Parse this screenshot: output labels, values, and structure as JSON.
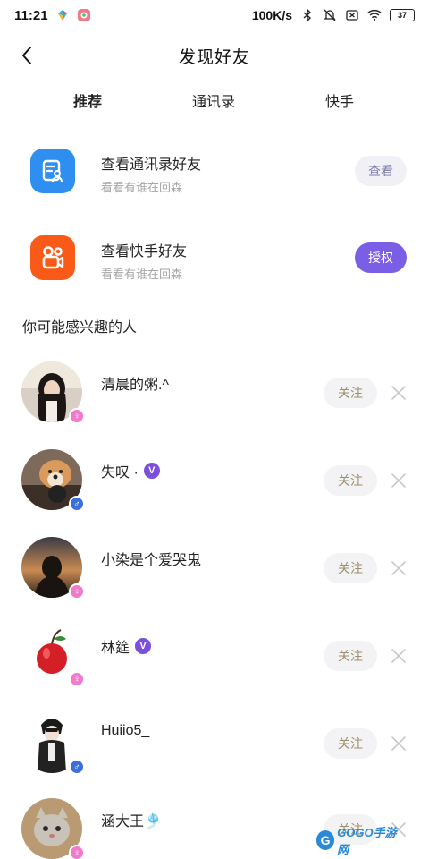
{
  "status_bar": {
    "time": "11:21",
    "network_speed": "100K/s",
    "battery": "37"
  },
  "header": {
    "title": "发现好友",
    "back_icon": "chevron-left-icon"
  },
  "tabs": [
    {
      "label": "推荐",
      "active": true
    },
    {
      "label": "通讯录",
      "active": false
    },
    {
      "label": "快手",
      "active": false
    }
  ],
  "sources": [
    {
      "title": "查看通讯录好友",
      "subtitle": "看看有谁在回森",
      "button": "查看",
      "icon": "contacts-icon",
      "icon_color": "#2f8ff0"
    },
    {
      "title": "查看快手好友",
      "subtitle": "看看有谁在回森",
      "button": "授权",
      "icon": "kuaishou-icon",
      "icon_color": "#fa5a18"
    }
  ],
  "section_title": "你可能感兴趣的人",
  "people": [
    {
      "name": "清晨的粥.^",
      "gender": "female",
      "gender_symbol": "♀",
      "verified": false,
      "follow_label": "关注"
    },
    {
      "name": "失叹 ·",
      "gender": "male",
      "gender_symbol": "♂",
      "verified": true,
      "verified_label": "V",
      "follow_label": "关注"
    },
    {
      "name": "小染是个爱哭鬼",
      "gender": "female",
      "gender_symbol": "♀",
      "verified": false,
      "follow_label": "关注"
    },
    {
      "name": "林筵",
      "gender": "female",
      "gender_symbol": "♀",
      "verified": true,
      "verified_label": "V",
      "follow_label": "关注"
    },
    {
      "name": "Huiio5_",
      "gender": "male",
      "gender_symbol": "♂",
      "verified": false,
      "follow_label": "关注"
    },
    {
      "name": "涵大王🎐",
      "gender": "female",
      "gender_symbol": "♀",
      "verified": false,
      "follow_label": "关注"
    }
  ],
  "watermark": {
    "letter": "G",
    "text": "GOGO手游网"
  }
}
